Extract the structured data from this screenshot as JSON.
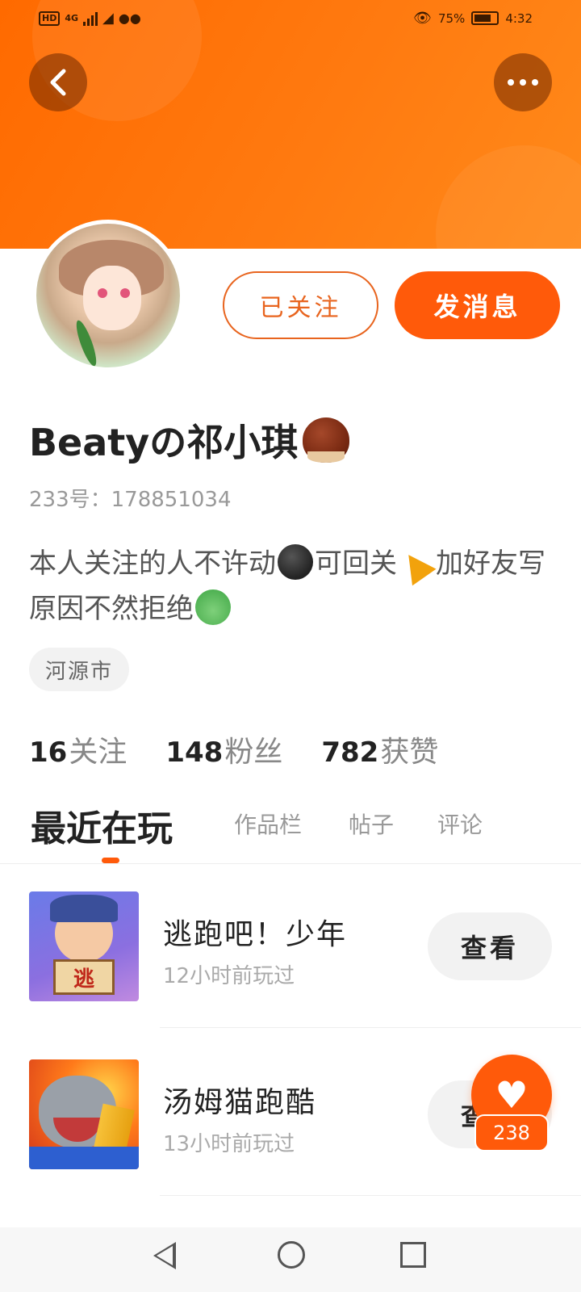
{
  "status_bar": {
    "network_badge": "HD",
    "network_type": "4G",
    "battery_percent": "75%",
    "time": "4:32"
  },
  "profile": {
    "follow_button_label": "已关注",
    "message_button_label": "发消息",
    "nickname": "Beatyの祁小琪",
    "id_line": "233号：178851034",
    "bio_part1": "本人关注的人不许动",
    "bio_part2": "可回关",
    "bio_part3": "加好友写原因不然拒绝",
    "location": "河源市"
  },
  "stats": [
    {
      "value": "16",
      "label": "关注"
    },
    {
      "value": "148",
      "label": "粉丝"
    },
    {
      "value": "782",
      "label": "获赞"
    }
  ],
  "tabs": [
    {
      "label": "最近在玩",
      "active": true
    },
    {
      "label": "作品栏",
      "active": false
    },
    {
      "label": "帖子",
      "active": false
    },
    {
      "label": "评论",
      "active": false
    }
  ],
  "games": [
    {
      "name": "逃跑吧！少年",
      "time": "12小时前玩过",
      "button": "查看",
      "icon_text": "逃"
    },
    {
      "name": "汤姆猫跑酷",
      "time": "13小时前玩过",
      "button": "查看"
    }
  ],
  "fab": {
    "count": "238"
  },
  "colors": {
    "accent": "#ff5a0a",
    "banner": "#ff7a10"
  }
}
